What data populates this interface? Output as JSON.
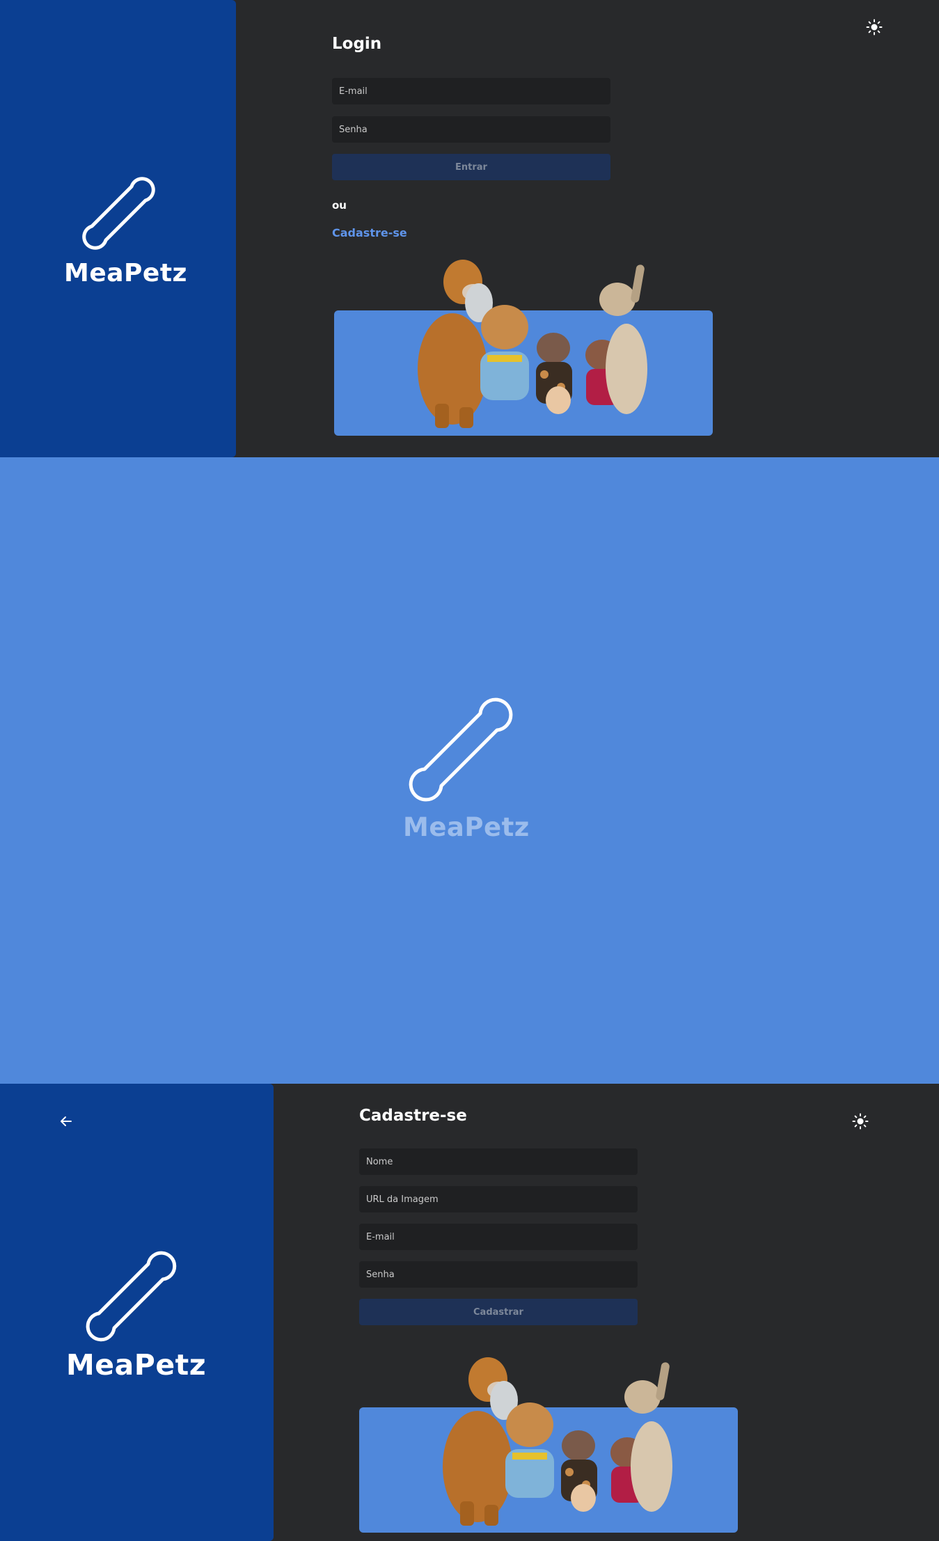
{
  "brand": {
    "name": "MeaPetz"
  },
  "login": {
    "title": "Login",
    "email_placeholder": "E-mail",
    "password_placeholder": "Senha",
    "submit_label": "Entrar",
    "or_text": "ou",
    "signup_link": "Cadastre-se",
    "theme_icon": "sun-icon"
  },
  "splash": {
    "background_color": "#5088db",
    "brand_name": "MeaPetz"
  },
  "signup": {
    "title": "Cadastre-se",
    "name_placeholder": "Nome",
    "image_url_placeholder": "URL da Imagem",
    "email_placeholder": "E-mail",
    "password_placeholder": "Senha",
    "submit_label": "Cadastrar",
    "back_icon": "arrow-left-icon",
    "theme_icon": "sun-icon"
  },
  "colors": {
    "brand_blue": "#0b3f92",
    "accent_blue": "#5088db",
    "page_dark": "#28292b",
    "field_bg": "#1f2022",
    "button_bg": "#1e3156",
    "link": "#5f94ea"
  }
}
